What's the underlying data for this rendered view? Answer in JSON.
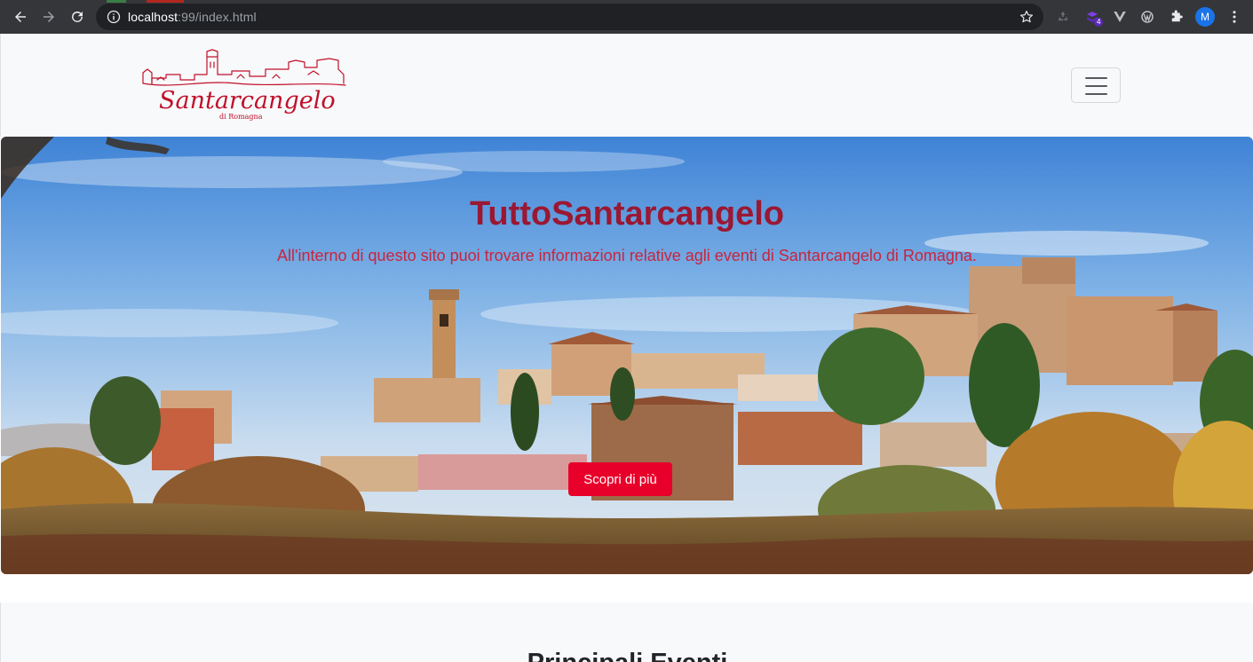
{
  "browser": {
    "url_host": "localhost",
    "url_path": ":99/index.html",
    "extension_badge": "4",
    "profile_initial": "M",
    "icons": [
      "back-icon",
      "forward-icon",
      "reload-icon",
      "info-icon",
      "bookmark-star-icon",
      "recycle-icon",
      "extension-icon",
      "vue-devtools-icon",
      "wordpress-icon",
      "puzzle-icon",
      "menu-dots-icon"
    ]
  },
  "navbar": {
    "logo_text": "Santarcangelo",
    "logo_subtext": "di Romagna",
    "toggler_icon": "hamburger-icon"
  },
  "hero": {
    "title": "TuttoSantarcangelo",
    "subtitle": "All'interno di questo sito puoi trovare informazioni relative agli eventi di Santarcangelo di Romagna.",
    "button_label": "Scopri di più"
  },
  "events": {
    "title": "Principali Eventi"
  },
  "colors": {
    "brand_red": "#e8002a",
    "title_red": "#9b1732",
    "chrome_dark": "#35363a"
  }
}
